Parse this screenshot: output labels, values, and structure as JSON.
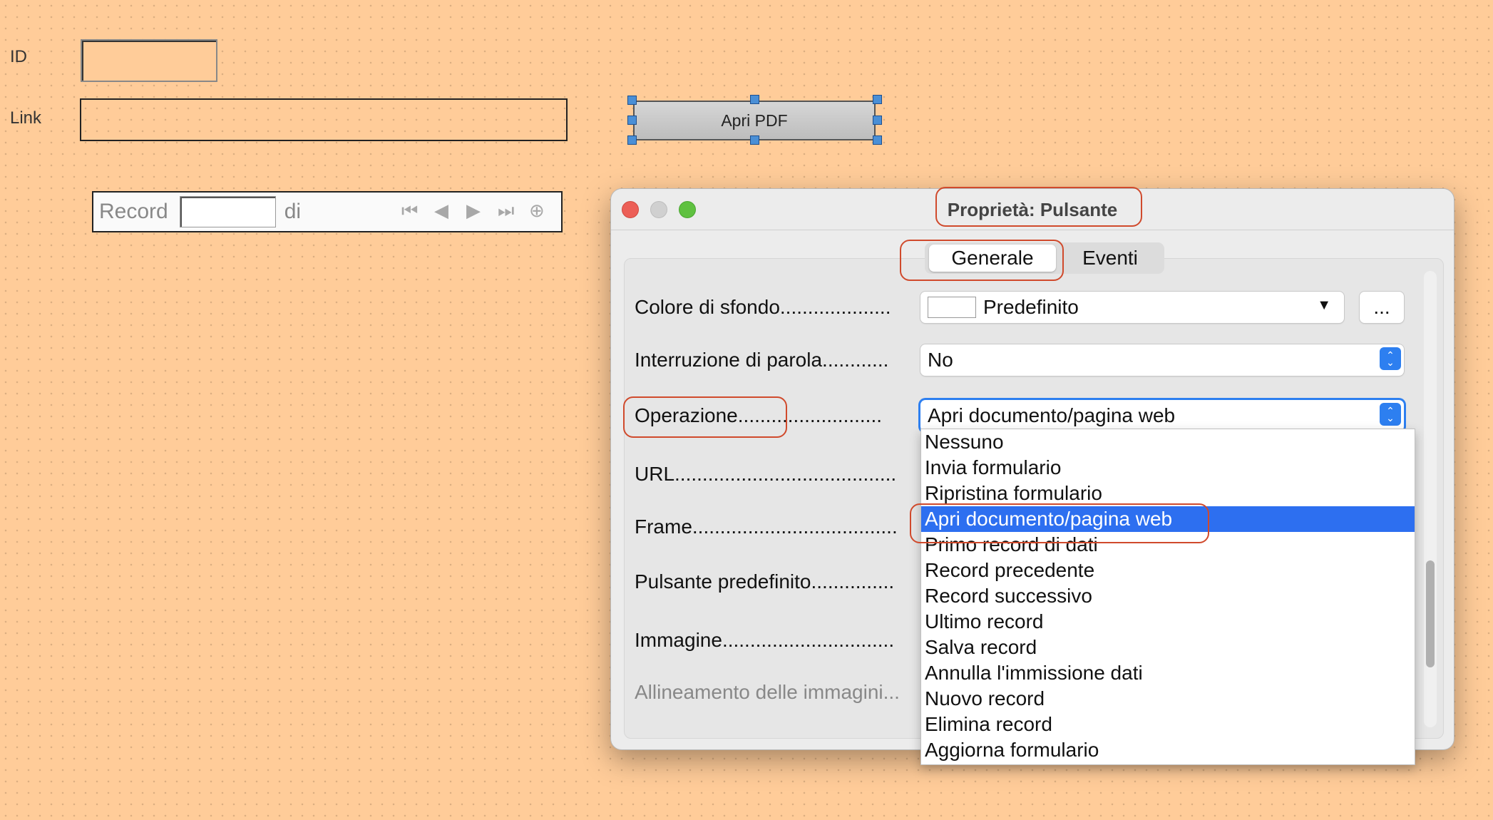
{
  "form": {
    "id_label": "ID",
    "link_label": "Link",
    "button_label": "Apri PDF",
    "navigation": {
      "record_label": "Record",
      "of_label": "di",
      "icons": [
        "first-record-icon",
        "previous-record-icon",
        "next-record-icon",
        "last-record-icon",
        "new-record-icon"
      ]
    }
  },
  "dialog": {
    "title": "Proprietà: Pulsante",
    "tabs": [
      "Generale",
      "Eventi"
    ],
    "active_tab": "Generale",
    "properties": {
      "background_color": {
        "label": "Colore di sfondo....................",
        "value": "Predefinito",
        "more": "..."
      },
      "word_break": {
        "label": "Interruzione di parola............",
        "value": "No"
      },
      "action": {
        "label_main": "Operazione......",
        "label_tail": "....................",
        "value": "Apri documento/pagina web"
      },
      "url": {
        "label": "URL........................................"
      },
      "frame": {
        "label": "Frame.....................................",
        "value": ""
      },
      "default_button": {
        "label": "Pulsante predefinito..............."
      },
      "image": {
        "label": "Immagine..............................."
      },
      "image_alignment": {
        "label": "Allineamento delle immagini..."
      }
    },
    "action_options": [
      "Nessuno",
      "Invia formulario",
      "Ripristina formulario",
      "Apri documento/pagina web",
      "Primo record di dati",
      "Record precedente",
      "Record successivo",
      "Ultimo record",
      "Salva record",
      "Annulla l'immissione dati",
      "Nuovo record",
      "Elimina record",
      "Aggiorna formulario"
    ],
    "selected_option_index": 3
  },
  "colors": {
    "canvas": "#ffcc99",
    "highlight": "#d04a2c",
    "selection": "#2d6ff0",
    "close": "#ec5f57",
    "minimize_inactive": "#d0d0d0",
    "zoom": "#5fc140"
  }
}
